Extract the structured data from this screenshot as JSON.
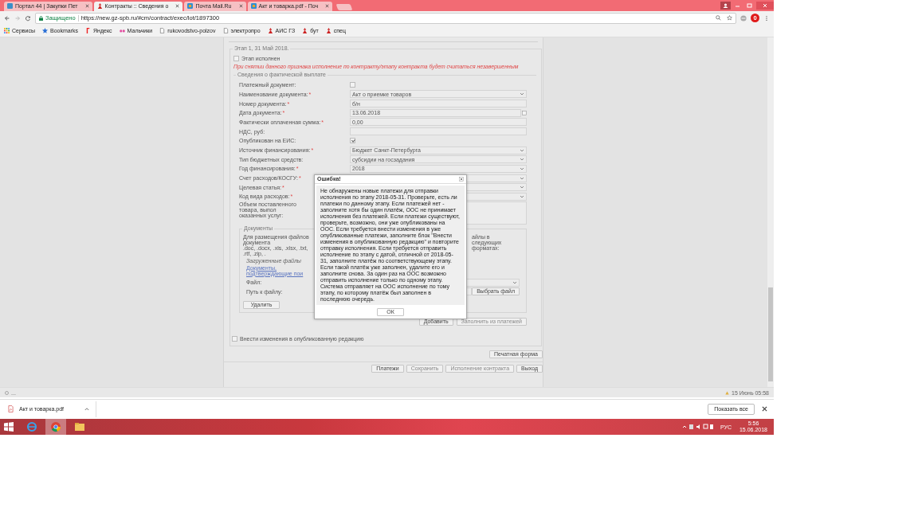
{
  "browser": {
    "tabs": [
      {
        "label": "Портал 44 | Закупки Пет",
        "selected": false
      },
      {
        "label": "Контракты :: Сведения о",
        "selected": true
      },
      {
        "label": "Почта Mail.Ru",
        "selected": false
      },
      {
        "label": "Акт и товарка.pdf - Поч",
        "selected": false
      }
    ],
    "secure": "Защищено",
    "url": "https://new.gz-spb.ru/#cm/contract/exec/lot/1897300",
    "extension_badge": "0",
    "bookmarks": [
      "Сервисы",
      "Bookmarks",
      "Яндекс",
      "Мальчики",
      "rukovodstvo-polzov",
      "электропро",
      "АИС ГЗ",
      "бут",
      "спец"
    ]
  },
  "stage": {
    "title": "Этап 1, 31 Май 2018.",
    "done_label": "Этап исполнен",
    "done_checked": false,
    "warning": "При снятии данного признака исполнение по контракту/этапу контракта будет считаться незавершенным"
  },
  "payment": {
    "title": "Сведения о фактической выплате",
    "fields": [
      {
        "kind": "checkbox",
        "label": "Платежный документ:",
        "checked": false
      },
      {
        "kind": "select",
        "label": "Наименование документа:",
        "required_mark": "*",
        "value": "Акт о приемке товаров"
      },
      {
        "kind": "text",
        "label": "Номер документа:",
        "required_mark": "*",
        "value": "б/н"
      },
      {
        "kind": "date",
        "label": "Дата документа:",
        "required_mark": "*",
        "value": "13.06.2018"
      },
      {
        "kind": "text",
        "label": "Фактически оплаченная сумма:",
        "required_mark": "*",
        "value": "0,00"
      },
      {
        "kind": "text",
        "label": "НДС, руб:"
      },
      {
        "kind": "checkbox",
        "label": "Опубликован на ЕИС:",
        "checked": true
      },
      {
        "kind": "select",
        "label": "Источник финансирования:",
        "required_mark": "*",
        "value": "Бюджет Санкт-Петербурга"
      },
      {
        "kind": "select",
        "label": "Тип бюджетных средств:",
        "value": "субсидии на госзадания"
      },
      {
        "kind": "select",
        "label": "Год финансирования:",
        "required_mark": "*",
        "value": "2018"
      },
      {
        "kind": "select",
        "label": "Счет расходов/КОСГУ:",
        "required_mark": "*"
      },
      {
        "kind": "select",
        "label": "Целевая статья:",
        "required_mark": "*"
      },
      {
        "kind": "select",
        "label": "Код вида расходов:",
        "required_mark": "*"
      },
      {
        "kind": "textarea",
        "label": "Объем поставленного товара, выпол\nоказанных услуг:"
      }
    ]
  },
  "documents": {
    "title": "Документы",
    "hint": "Для размещения файлов документа\n.doc, .docx, .xls, .xlsx, .txt, .rtf, .zip, .",
    "hint_right": "айлы в следующих форматах:",
    "uploaded_label": "Загруженные файлы",
    "link": "Документы, подтверждающие пои",
    "file_label": "Файл:",
    "path_label": "Путь к файлу:",
    "choose_button": "Выбрать файл",
    "delete_button": "Удалить"
  },
  "actions": [
    {
      "label": "Добавить",
      "disabled": false
    },
    {
      "label": "Заполнить из платежей",
      "disabled": true
    }
  ],
  "publish": {
    "label": "Внести изменения в опубликованную редакцию",
    "checked": false
  },
  "print_button": "Печатная форма",
  "footer_buttons": [
    {
      "label": "Платежи",
      "disabled": false
    },
    {
      "label": "Сохранить",
      "disabled": true
    },
    {
      "label": "Исполнение контракта",
      "disabled": true
    },
    {
      "label": "Выход",
      "disabled": false
    }
  ],
  "dialog": {
    "title": "Ошибка!",
    "message": "Не обнаружены новые платежи для отправки исполнения по этапу 2018-05-31. Проверьте, есть ли платежи по данному этапу. Если платежей нет - заполните хотя бы один платёж, ООС не принимает исполнения без платежей. Если платежи существуют, проверьте, возможно, они уже опубликованы на ООС. Если требуется внести изменения в уже опубликованные платежи, заполните блок \"Внести изменения в опубликованную редакцию\" и повторите отправку исполнения. Если требуется отправить исполнение по этапу с датой, отличной от 2018-05-31, заполните платёж по соответствующему этапу. Если такой платёж уже заполнен, удалите его и заполните снова. За один раз на ООС возможно отправить исполнение только по одному этапу. Система отправляет на ООС исполнение по тому этапу, по которому платёж был заполнен в последнюю очередь.",
    "ok": "ОК"
  },
  "status_bar": {
    "left": "...",
    "right": "15 Июнь 05:58"
  },
  "downloads": {
    "file": "Акт и товарка.pdf",
    "show_all": "Показать все"
  },
  "taskbar": {
    "apps": [
      {
        "selected": false
      },
      {
        "selected": true
      },
      {
        "selected": false
      }
    ],
    "language": "РУС",
    "time": "5:56",
    "date": "15.06.2018"
  }
}
